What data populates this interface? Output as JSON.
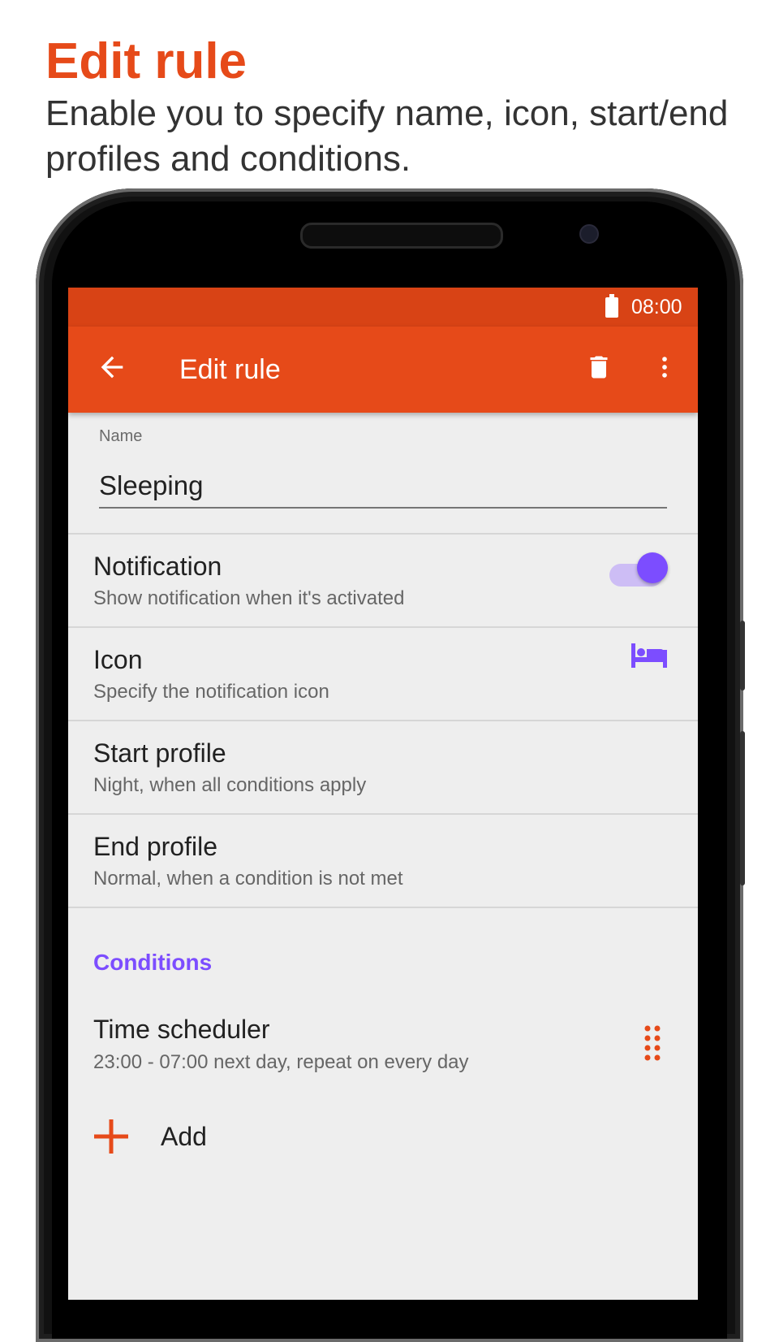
{
  "promo": {
    "title": "Edit rule",
    "subtitle": "Enable you to specify name, icon, start/end profiles and conditions."
  },
  "statusbar": {
    "time": "08:00",
    "battery_icon": "battery-full-icon"
  },
  "appbar": {
    "title": "Edit rule",
    "back_icon": "arrow-back-icon",
    "delete_icon": "trash-icon",
    "more_icon": "more-vert-icon"
  },
  "form": {
    "name_label": "Name",
    "name_value": "Sleeping"
  },
  "settings": {
    "notification": {
      "title": "Notification",
      "subtitle": "Show notification when it's activated",
      "enabled": true
    },
    "icon": {
      "title": "Icon",
      "subtitle": "Specify the notification icon",
      "icon": "bed-icon"
    },
    "start_profile": {
      "title": "Start profile",
      "subtitle": "Night, when all conditions apply"
    },
    "end_profile": {
      "title": "End profile",
      "subtitle": "Normal, when a condition is not met"
    }
  },
  "conditions": {
    "header": "Conditions",
    "items": [
      {
        "title": "Time scheduler",
        "subtitle": "23:00 - 07:00 next day, repeat on every day",
        "handle_icon": "drag-handle-icon"
      }
    ],
    "add_label": "Add",
    "add_icon": "plus-icon"
  },
  "colors": {
    "accent": "#e64a19",
    "statusbar": "#d84315",
    "secondary": "#7c4dff",
    "background": "#eeeeee"
  }
}
